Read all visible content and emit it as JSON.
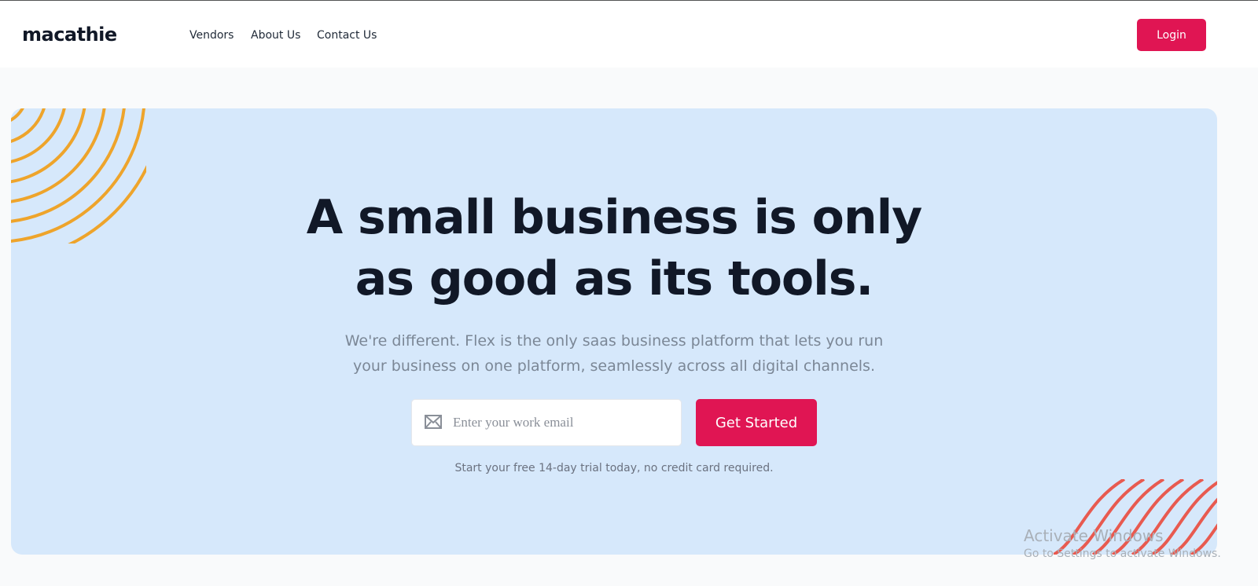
{
  "brand": {
    "logo_text": "macathie"
  },
  "nav": {
    "links": [
      "Vendors",
      "About Us",
      "Contact Us"
    ],
    "login_label": "Login"
  },
  "hero": {
    "headline_line1": "A small business is only",
    "headline_line2": "as good as its tools.",
    "subtext_line1": "We're different. Flex is the only saas business platform that lets you run",
    "subtext_line2": "your business on one platform, seamlessly across all digital channels.",
    "email_placeholder": "Enter your work email",
    "email_value": "",
    "cta_label": "Get Started",
    "trial_note": "Start your free 14-day trial today, no credit card required."
  },
  "watermark": {
    "title": "Activate Windows",
    "subtitle": "Go to Settings to activate Windows."
  },
  "colors": {
    "accent": "#e01553",
    "hero_bg": "#d6e8fb",
    "deco_orange": "#eea42b",
    "deco_red": "#e85a50"
  },
  "icons": {
    "email": "envelope-icon"
  }
}
